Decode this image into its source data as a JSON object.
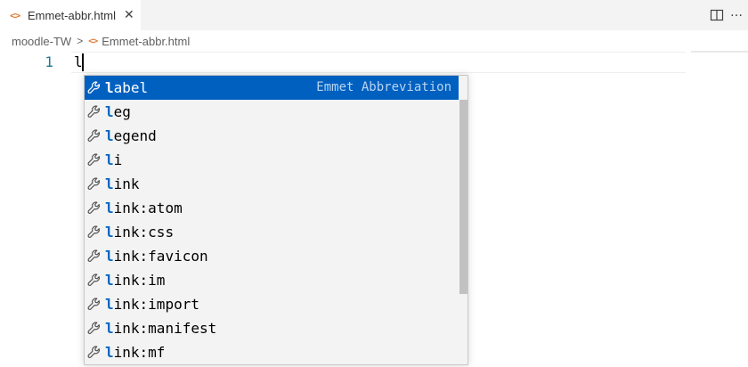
{
  "tab": {
    "icon": "<>",
    "title": "Emmet-abbr.html",
    "close_glyph": "✕"
  },
  "toolbar": {
    "split_icon": "split-editor-icon",
    "more_glyph": "…"
  },
  "breadcrumb": {
    "folder": "moodle-TW",
    "separator": ">",
    "file_icon": "<>",
    "file": "Emmet-abbr.html"
  },
  "editor": {
    "line_number": "1",
    "text": "l"
  },
  "suggest": {
    "detail": "Emmet Abbreviation",
    "items": [
      {
        "match": "l",
        "rest": "abel"
      },
      {
        "match": "l",
        "rest": "eg"
      },
      {
        "match": "l",
        "rest": "egend"
      },
      {
        "match": "l",
        "rest": "i"
      },
      {
        "match": "l",
        "rest": "ink"
      },
      {
        "match": "l",
        "rest": "ink:atom"
      },
      {
        "match": "l",
        "rest": "ink:css"
      },
      {
        "match": "l",
        "rest": "ink:favicon"
      },
      {
        "match": "l",
        "rest": "ink:im"
      },
      {
        "match": "l",
        "rest": "ink:import"
      },
      {
        "match": "l",
        "rest": "ink:manifest"
      },
      {
        "match": "l",
        "rest": "ink:mf"
      }
    ],
    "selected_index": 0
  },
  "colors": {
    "accent": "#0060c0",
    "html_icon": "#e37933",
    "line_number": "#237893"
  }
}
